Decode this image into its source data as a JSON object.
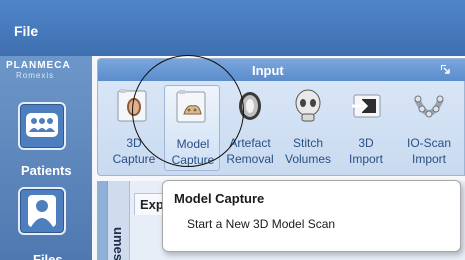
{
  "menu": {
    "file_label": "File"
  },
  "brand": {
    "name": "PLANMECA",
    "product": "Romexis"
  },
  "sidebar": {
    "items": [
      {
        "label": "Patients",
        "icon": "patients-icon"
      },
      {
        "label": "Files",
        "icon": "files-icon"
      }
    ]
  },
  "ribbon": {
    "group_title": "Input",
    "tools": [
      {
        "line1": "3D",
        "line2": "Capture",
        "icon": "capture-3d-icon"
      },
      {
        "line1": "Model",
        "line2": "Capture",
        "icon": "model-capture-icon",
        "selected": true
      },
      {
        "line1": "Artefact",
        "line2": "Removal",
        "icon": "artefact-removal-icon"
      },
      {
        "line1": "Stitch",
        "line2": "Volumes",
        "icon": "stitch-volumes-icon"
      },
      {
        "line1": "3D",
        "line2": "Import",
        "icon": "import-3d-icon"
      },
      {
        "line1": "IO-Scan",
        "line2": "Import",
        "icon": "ioscan-import-icon"
      }
    ]
  },
  "content": {
    "vertical_tab_label": "umes",
    "panel_tab_label": "Exp"
  },
  "tooltip": {
    "title": "Model Capture",
    "description": "Start a New 3D Model Scan"
  },
  "colors": {
    "titlebar": "#4779bf",
    "sidebar": "#5f87bd",
    "ribbon_header": "#6a98d4",
    "tool_label": "#2a4f86"
  }
}
